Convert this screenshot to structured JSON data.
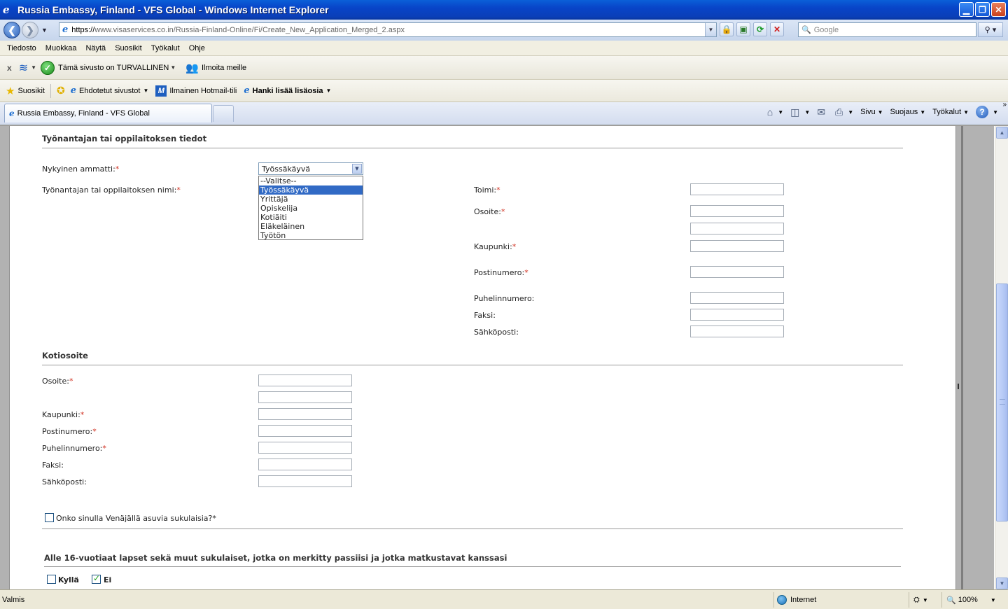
{
  "window": {
    "title": "Russia Embassy, Finland - VFS Global - Windows Internet Explorer"
  },
  "address": {
    "url_protocol": "https://",
    "url_rest": "www.visaservices.co.in/Russia-Finland-Online/Fi/Create_New_Application_Merged_2.aspx",
    "search_placeholder": "Google"
  },
  "menu": [
    "Tiedosto",
    "Muokkaa",
    "Näytä",
    "Suosikit",
    "Työkalut",
    "Ohje"
  ],
  "security_toolbar": {
    "safe_text": "Tämä sivusto on TURVALLINEN",
    "report_text": "Ilmoita meille"
  },
  "favorites": {
    "favorites_label": "Suosikit",
    "suggested": "Ehdotetut sivustot",
    "hotmail": "Ilmainen Hotmail-tili",
    "more_addons": "Hanki lisää lisäosia"
  },
  "tab": {
    "title": "Russia Embassy, Finland - VFS Global"
  },
  "commandbar": {
    "page": "Sivu",
    "safety": "Suojaus",
    "tools": "Työkalut"
  },
  "form": {
    "employer_section": {
      "title": "Työnantajan tai oppilaitoksen tiedot",
      "occupation_label": "Nykyinen ammatti:",
      "occupation_value": "Työssäkäyvä",
      "occupation_options": [
        "--Valitse--",
        "Työssäkäyvä",
        "Yrittäjä",
        "Opiskelija",
        "Kotiäiti",
        "Eläkeläinen",
        "Työtön"
      ],
      "employer_name_label": "Työnantajan tai oppilaitoksen nimi:",
      "industry_label": "Toimi:",
      "address_label": "Osoite:",
      "city_label": "Kaupunki:",
      "postcode_label": "Postinumero:",
      "phone_label": "Puhelinnumero:",
      "fax_label": "Faksi:",
      "email_label": "Sähköposti:"
    },
    "home_section": {
      "title": "Kotiosoite",
      "address_label": "Osoite:",
      "city_label": "Kaupunki:",
      "postcode_label": "Postinumero:",
      "phone_label": "Puhelinnumero:",
      "fax_label": "Faksi:",
      "email_label": "Sähköposti:"
    },
    "relatives_question": "Onko sinulla Venäjällä asuvia sukulaisia?*",
    "children_section": {
      "title": "Alle 16-vuotiaat lapset sekä muut sukulaiset, jotka on merkitty passiisi ja jotka matkustavat kanssasi",
      "yes_label": "Kyllä",
      "no_label": "Ei",
      "no_checked": true
    },
    "required_mark": "*"
  },
  "status": {
    "text": "Valmis",
    "zone": "Internet",
    "zoom": "100%"
  }
}
